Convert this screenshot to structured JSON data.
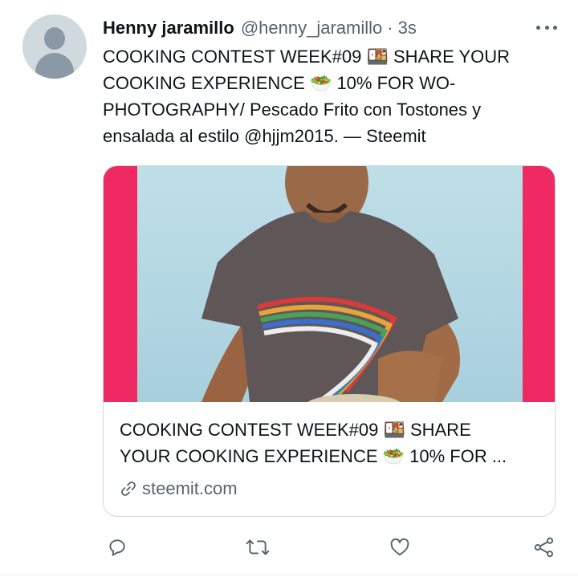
{
  "tweet": {
    "author": {
      "display_name": "Henny jaramillo",
      "handle": "@henny_jaramillo",
      "separator": "·",
      "time": "3s"
    },
    "text_line1": "COOKING CONTEST WEEK#09 🍱 SHARE YOUR",
    "text_line2": "COOKING EXPERIENCE 🥗 10% FOR WO-",
    "text_line3": "PHOTOGRAPHY/ Pescado Frito con Tostones y",
    "text_line4": "ensalada al estilo @hjjm2015. — Steemit",
    "card": {
      "title_line1": "COOKING CONTEST WEEK#09 🍱 SHARE",
      "title_line2": "YOUR COOKING EXPERIENCE 🥗 10% FOR ...",
      "domain": "steemit.com",
      "media_border_color": "#ef2a63"
    },
    "actions": [
      {
        "name": "reply-icon"
      },
      {
        "name": "retweet-icon"
      },
      {
        "name": "like-icon"
      },
      {
        "name": "share-icon"
      }
    ]
  },
  "colors": {
    "text_primary": "#0f1419",
    "text_secondary": "#536471",
    "border": "#cfd9de"
  }
}
